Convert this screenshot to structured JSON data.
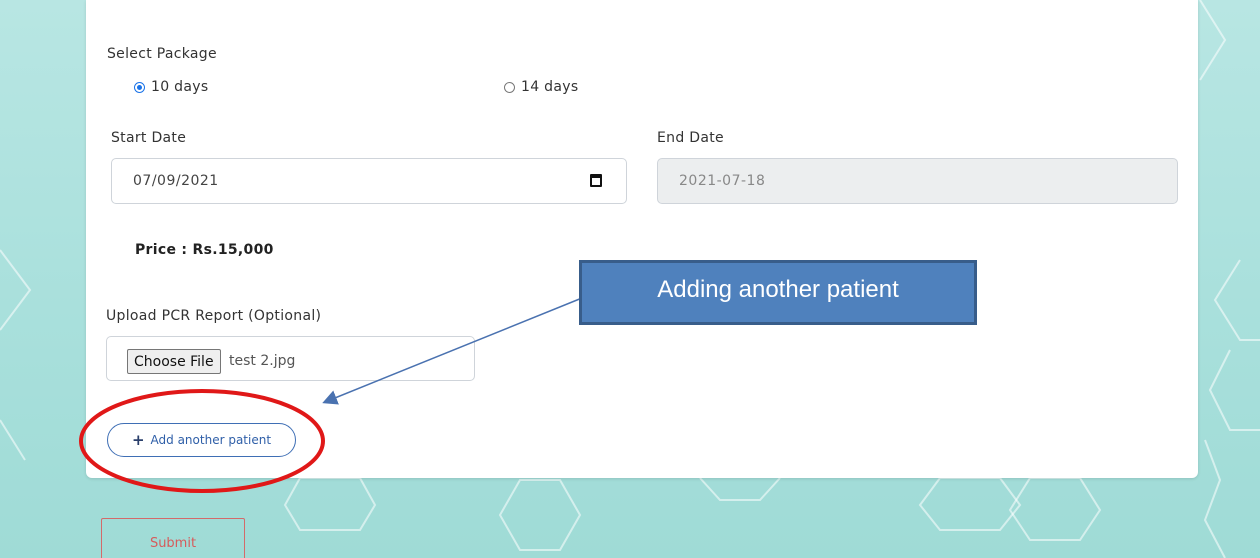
{
  "form": {
    "select_package_label": "Select Package",
    "package_options": [
      {
        "label": "10 days",
        "checked": true
      },
      {
        "label": "14 days",
        "checked": false
      }
    ],
    "start_date_label": "Start Date",
    "start_date_value": "07/09/2021",
    "end_date_label": "End Date",
    "end_date_value": "2021-07-18",
    "price_text": "Price : Rs.15,000",
    "upload_label": "Upload PCR Report (Optional)",
    "choose_file_label": "Choose File",
    "file_name": "test 2.jpg",
    "add_patient_icon": "+",
    "add_patient_label": "Add another patient",
    "submit_label": "Submit"
  },
  "annotation": {
    "callout_text": "Adding another patient",
    "callout_color": "#4f81bd",
    "circle_color": "#e01818"
  },
  "colors": {
    "background": "#a9e0dc",
    "accent_blue": "#3f6fb5",
    "submit_red": "#d65b5b"
  }
}
